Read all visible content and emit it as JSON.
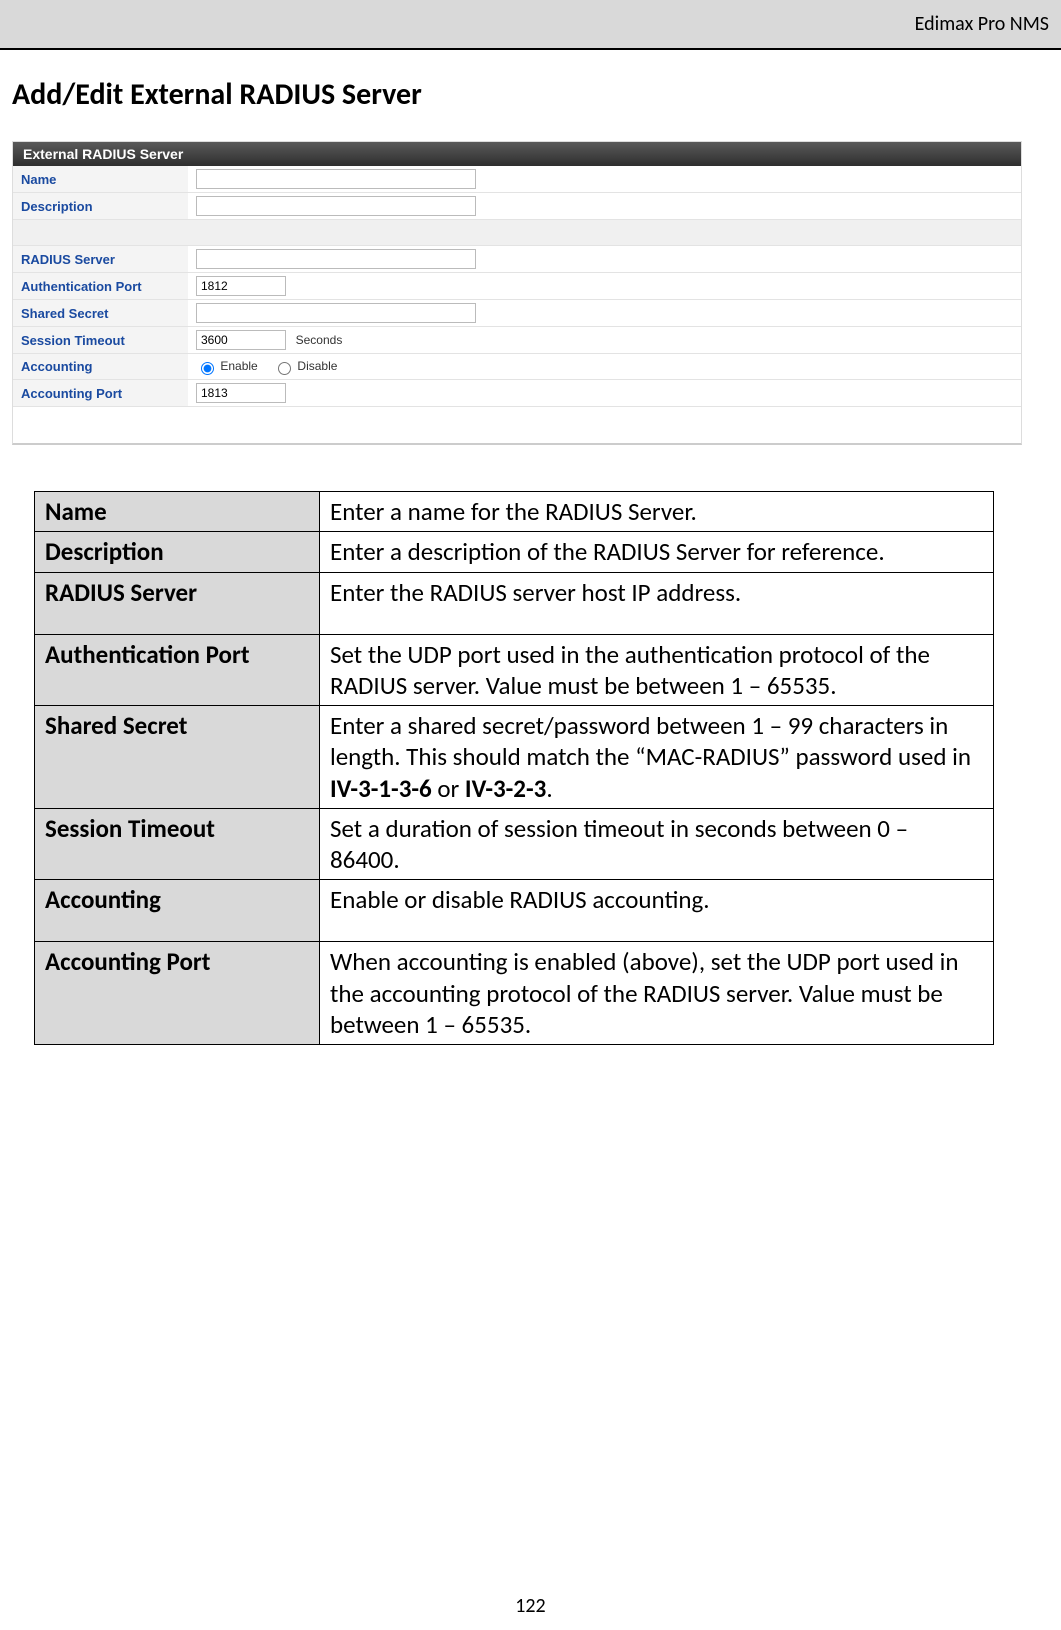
{
  "header": {
    "product": "Edimax Pro NMS"
  },
  "title": "Add/Edit External RADIUS Server",
  "panel": {
    "title": "External RADIUS Server",
    "fields": {
      "name_label": "Name",
      "name_value": "",
      "description_label": "Description",
      "description_value": "",
      "radius_server_label": "RADIUS Server",
      "radius_server_value": "",
      "auth_port_label": "Authentication Port",
      "auth_port_value": "1812",
      "shared_secret_label": "Shared Secret",
      "shared_secret_value": "",
      "session_timeout_label": "Session Timeout",
      "session_timeout_value": "3600",
      "session_timeout_unit": "Seconds",
      "accounting_label": "Accounting",
      "accounting_enable": "Enable",
      "accounting_disable": "Disable",
      "accounting_selected": "enable",
      "accounting_port_label": "Accounting Port",
      "accounting_port_value": "1813"
    }
  },
  "desc_rows": [
    {
      "key": "Name",
      "val": "Enter a name for the RADIUS Server."
    },
    {
      "key": "Description",
      "val": "Enter a description of the RADIUS Server for reference."
    },
    {
      "key": "RADIUS Server",
      "val": "Enter the RADIUS server host IP address."
    },
    {
      "key": "Authentication Port",
      "val": "Set the UDP port used in the authentication protocol of the RADIUS server. Value must be between 1 – 65535."
    },
    {
      "key": "Shared Secret",
      "val_html": "Enter a shared secret/password between 1 – 99 characters in length. This should match the “MAC-RADIUS” password used in <span class=\"b\">IV-3-1-3-6</span> or <span class=\"b\">IV-3-2-3</span>."
    },
    {
      "key": "Session Timeout",
      "val": "Set a duration of session timeout in seconds between 0 – 86400."
    },
    {
      "key": "Accounting",
      "val": "Enable or disable RADIUS accounting."
    },
    {
      "key": "Accounting Port",
      "val": "When accounting is enabled (above), set the UDP port used in the accounting protocol of the RADIUS server. Value must be between 1 – 65535."
    }
  ],
  "page_number": "122"
}
